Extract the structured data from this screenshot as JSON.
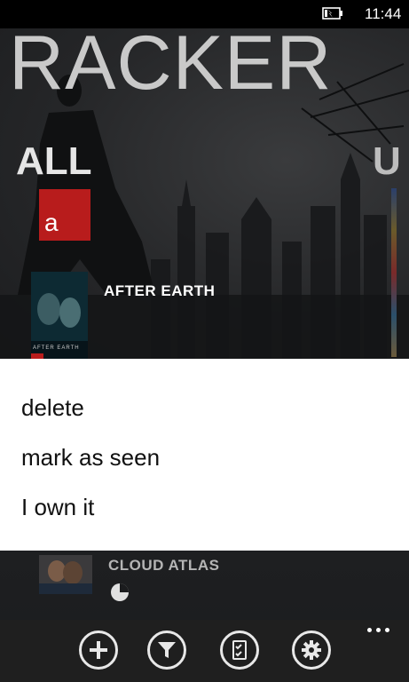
{
  "status_bar": {
    "time": "11:44",
    "battery_icon": "battery-charging-icon"
  },
  "header": {
    "app_title": "RACKER",
    "pivot_current": "ALL",
    "pivot_next_peek": "U"
  },
  "jump_list_letter": "a",
  "movies": [
    {
      "title": "AFTER EARTH",
      "poster_caption": "AFTER EARTH"
    },
    {
      "title": "CLOUD ATLAS",
      "status_icon": "seen-status-icon"
    }
  ],
  "context_menu": {
    "items": [
      "delete",
      "mark as seen",
      "I own it"
    ]
  },
  "app_bar": {
    "buttons": [
      {
        "icon": "add-icon"
      },
      {
        "icon": "filter-icon"
      },
      {
        "icon": "checklist-icon"
      },
      {
        "icon": "settings-icon"
      }
    ],
    "more": "more-icon"
  },
  "colors": {
    "accent": "#b81c1c",
    "menu_bg": "#ffffff",
    "app_bar_bg": "#1f1f1f"
  }
}
